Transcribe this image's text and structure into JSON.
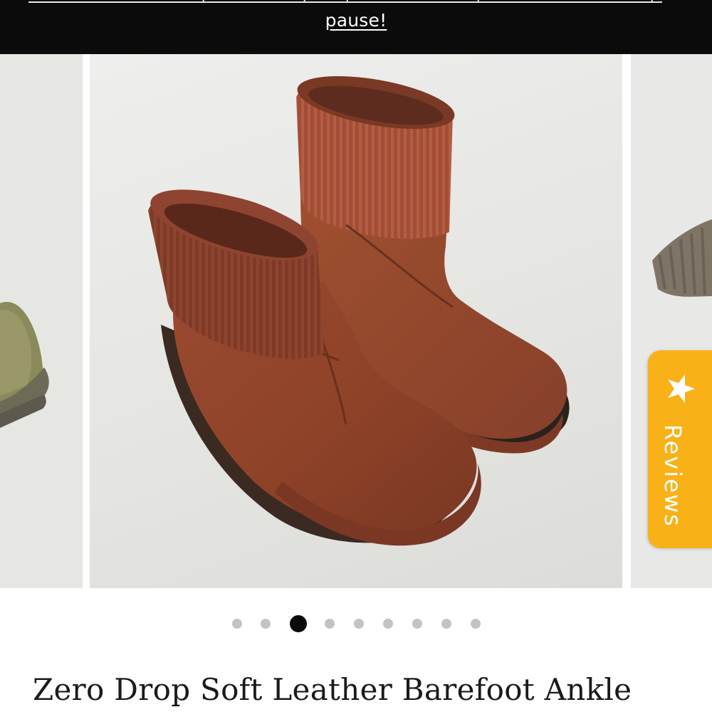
{
  "banner": {
    "link_text": "pause!",
    "background": "#0b0b0b",
    "text_color": "#ffffff"
  },
  "gallery": {
    "current_slide_alt": "Rust brown suede ankle boots with ribbed knit sock collar",
    "slides_total": 9,
    "active_index": 2
  },
  "reviews_tab": {
    "label": "Reviews",
    "icon": "star-icon",
    "color": "#f8b117"
  },
  "pagination": {
    "dots": [
      {
        "label": "Slide 1"
      },
      {
        "label": "Slide 2"
      },
      {
        "label": "Slide 3"
      },
      {
        "label": "Slide 4"
      },
      {
        "label": "Slide 5"
      },
      {
        "label": "Slide 6"
      },
      {
        "label": "Slide 7"
      },
      {
        "label": "Slide 8"
      },
      {
        "label": "Slide 9"
      }
    ],
    "active_color": "#0a0a0a",
    "inactive_color": "#c3c3c3"
  },
  "product": {
    "title": "Zero Drop Soft Leather Barefoot Ankle"
  }
}
